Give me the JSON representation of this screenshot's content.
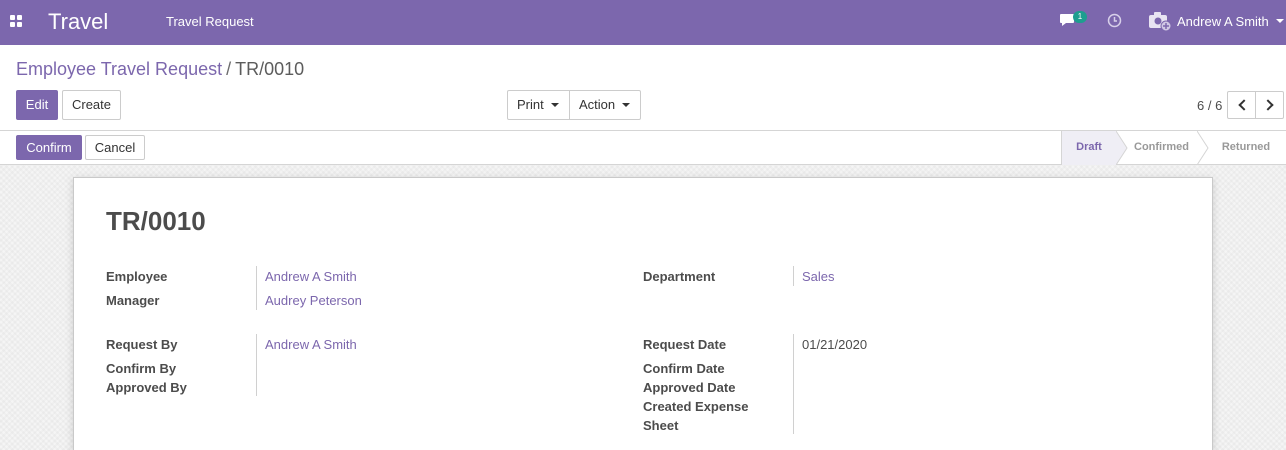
{
  "navbar": {
    "brand": "Travel",
    "menu_item": "Travel Request",
    "chat_badge": "1",
    "user_name": "Andrew A Smith",
    "icons": [
      "apps-icon",
      "chat-icon",
      "clock-icon",
      "avatar-icon"
    ]
  },
  "breadcrumb": {
    "parent": "Employee Travel Request",
    "separator": "/",
    "current": "TR/0010"
  },
  "toolbar": {
    "edit_label": "Edit",
    "create_label": "Create",
    "print_label": "Print",
    "action_label": "Action"
  },
  "pager": {
    "value": "6 / 6"
  },
  "statusbar": {
    "confirm_label": "Confirm",
    "cancel_label": "Cancel",
    "stages": [
      "Draft",
      "Confirmed",
      "Returned"
    ],
    "active_stage": "Draft"
  },
  "form": {
    "title": "TR/0010",
    "employee_label": "Employee",
    "employee_value": "Andrew A Smith",
    "manager_label": "Manager",
    "manager_value": "Audrey Peterson",
    "department_label": "Department",
    "department_value": "Sales",
    "request_by_label": "Request By",
    "request_by_value": "Andrew A Smith",
    "confirm_by_label": "Confirm By",
    "approved_by_label": "Approved By",
    "request_date_label": "Request Date",
    "request_date_value": "01/21/2020",
    "confirm_date_label": "Confirm Date",
    "approved_date_label": "Approved Date",
    "created_expense_label_1": "Created Expense",
    "created_expense_label_2": "Sheet"
  },
  "colors": {
    "brand": "#7c67ad",
    "badge": "#1e9e8f"
  }
}
